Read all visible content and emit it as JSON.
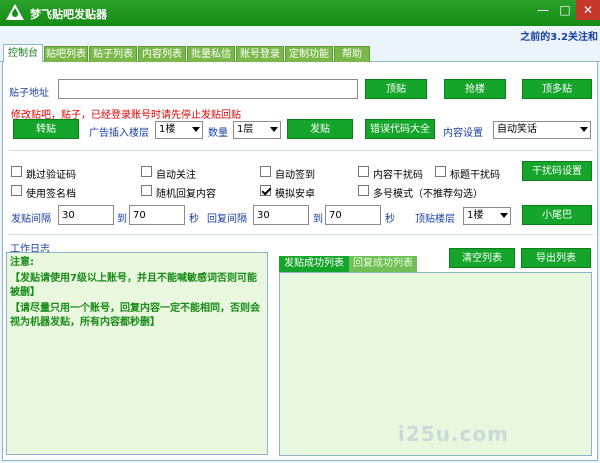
{
  "window": {
    "title": "梦飞贴吧发贴器",
    "minimize_glyph": "—",
    "maximize_glyph": "□",
    "close_glyph": "✕",
    "marquee": "之前的3.2关注和"
  },
  "tabs": [
    {
      "label": "控制台"
    },
    {
      "label": "贴吧列表"
    },
    {
      "label": "贴子列表"
    },
    {
      "label": "内容列表"
    },
    {
      "label": "批量私信"
    },
    {
      "label": "账号登录"
    },
    {
      "label": "定制功能"
    },
    {
      "label": "帮助"
    }
  ],
  "post": {
    "url_label": "贴子地址",
    "url_value": "",
    "top_post_button": "顶贴",
    "grab_floor_button": "抢楼",
    "top_more_button": "顶多贴",
    "warning": "修改贴吧，贴子，已经登录账号时请先停止发贴回贴",
    "repost_button": "转贴",
    "ad_floor_label": "广告插入楼层",
    "ad_floor_value": "1楼",
    "count_label": "数量",
    "count_value": "1层",
    "publish_button": "发贴",
    "error_code_button": "错误代码大全",
    "content_setting_label": "内容设置",
    "content_setting_value": "自动笑话"
  },
  "options": {
    "skip_captcha": "跳过验证码",
    "auto_follow": "自动关注",
    "auto_signin": "自动签到",
    "content_noise": "内容干扰码",
    "title_noise": "标题干扰码",
    "noise_setting_button": "干扰码设置",
    "use_signature": "使用签名档",
    "random_reply": "随机回复内容",
    "simulate_android": "模拟安卓",
    "multi_account": "多号模式（不推荐勾选）"
  },
  "interval": {
    "post_interval_label": "发贴间隔",
    "post_from": "30",
    "to_label_1": "到",
    "post_to": "70",
    "sec_label_1": "秒",
    "reply_interval_label": "回复间隔",
    "reply_from": "30",
    "to_label_2": "到",
    "reply_to": "70",
    "sec_label_2": "秒",
    "top_floor_label": "顶贴楼层",
    "top_floor_value": "1楼",
    "tail_button": "小尾巴"
  },
  "log": {
    "title": "工作日志",
    "line_note": "注意:",
    "line_1": "【发贴请使用7级以上账号，并且不能喊敏感词否则可能被删】",
    "line_2": "【请尽量只用一个账号，回复内容一定不能相同，否则会视为机器发贴，所有内容都秒删】"
  },
  "lists": {
    "clear_button": "清空列表",
    "export_button": "导出列表",
    "tab_send_success": "发贴成功列表",
    "tab_reply_success": "回复成功列表"
  },
  "watermark": "i25u.com"
}
